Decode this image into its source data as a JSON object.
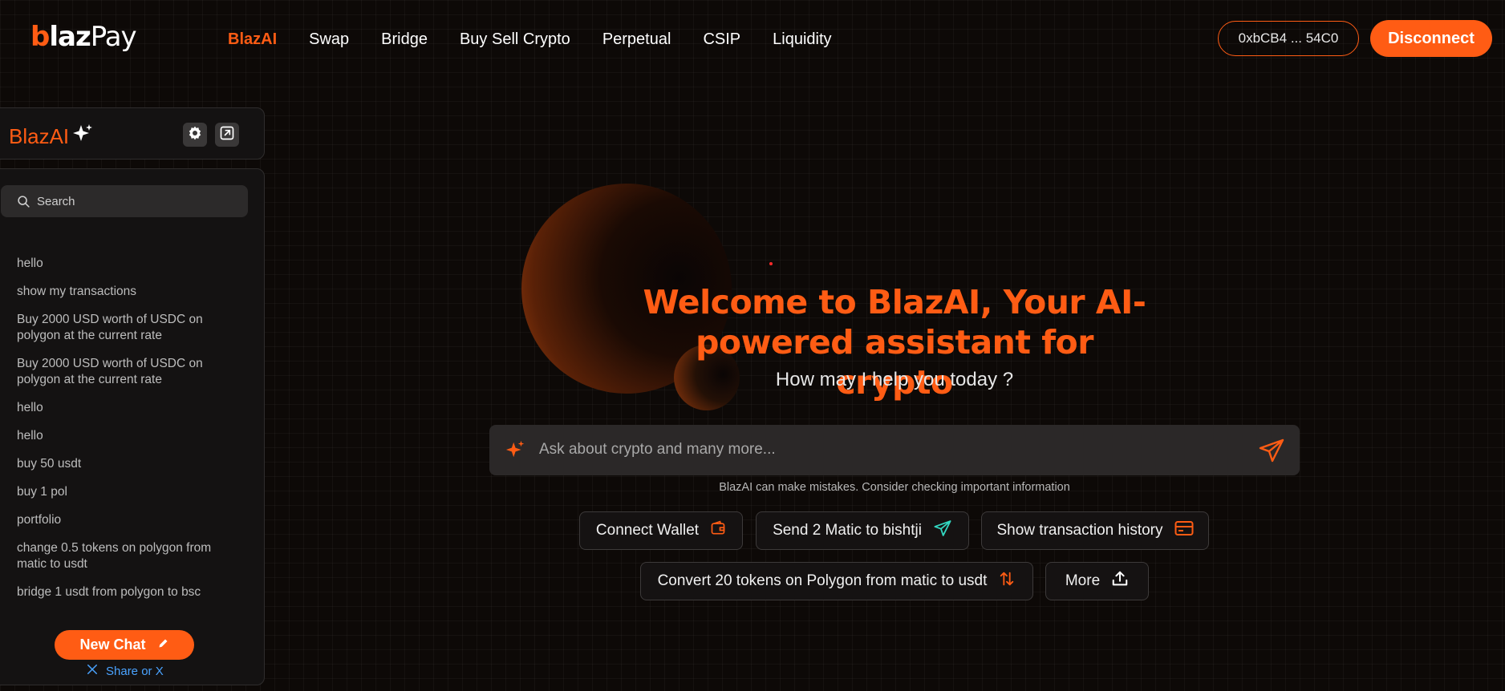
{
  "brand": {
    "logo_b": "b",
    "logo_laz": "laz",
    "logo_pay": "Pay",
    "accent_color": "#ff5c14"
  },
  "nav": {
    "items": [
      {
        "label": "BlazAI",
        "active": true
      },
      {
        "label": "Swap"
      },
      {
        "label": "Bridge"
      },
      {
        "label": "Buy Sell Crypto"
      },
      {
        "label": "Perpetual"
      },
      {
        "label": "CSIP"
      },
      {
        "label": "Liquidity"
      }
    ],
    "wallet_address": "0xbCB4 ... 54C0",
    "disconnect_label": "Disconnect"
  },
  "sidebar": {
    "title": "BlazAI",
    "title_icon": "sparkle-icon",
    "settings_icon": "gear-icon",
    "expand_icon": "external-link-icon",
    "search_placeholder": "Search",
    "history": [
      "hello",
      "show my transactions",
      "Buy 2000 USD worth of USDC on polygon at the current rate",
      "Buy 2000 USD worth of USDC on polygon at the current rate",
      "hello",
      "hello",
      "buy 50 usdt",
      "buy 1 pol",
      "portfolio",
      "change 0.5 tokens on polygon from matic to usdt",
      "bridge 1 usdt from polygon to bsc"
    ],
    "new_chat_label": "New Chat",
    "share_label": "Share or X"
  },
  "hero": {
    "title": "Welcome to BlazAI, Your AI-powered assistant for crypto",
    "subtitle": "How may I help you today ?"
  },
  "prompt": {
    "placeholder": "Ask about crypto and many more...",
    "disclaimer": "BlazAI can make mistakes. Consider checking important information"
  },
  "suggestions": [
    {
      "label": "Connect Wallet",
      "icon": "wallet-icon"
    },
    {
      "label": "Send 2 Matic to bishtji",
      "icon": "send-icon"
    },
    {
      "label": "Show transaction history",
      "icon": "card-icon"
    },
    {
      "label": "Convert 20 tokens on Polygon from matic to usdt",
      "icon": "swap-arrows-icon"
    },
    {
      "label": "More",
      "icon": "upload-icon"
    }
  ]
}
